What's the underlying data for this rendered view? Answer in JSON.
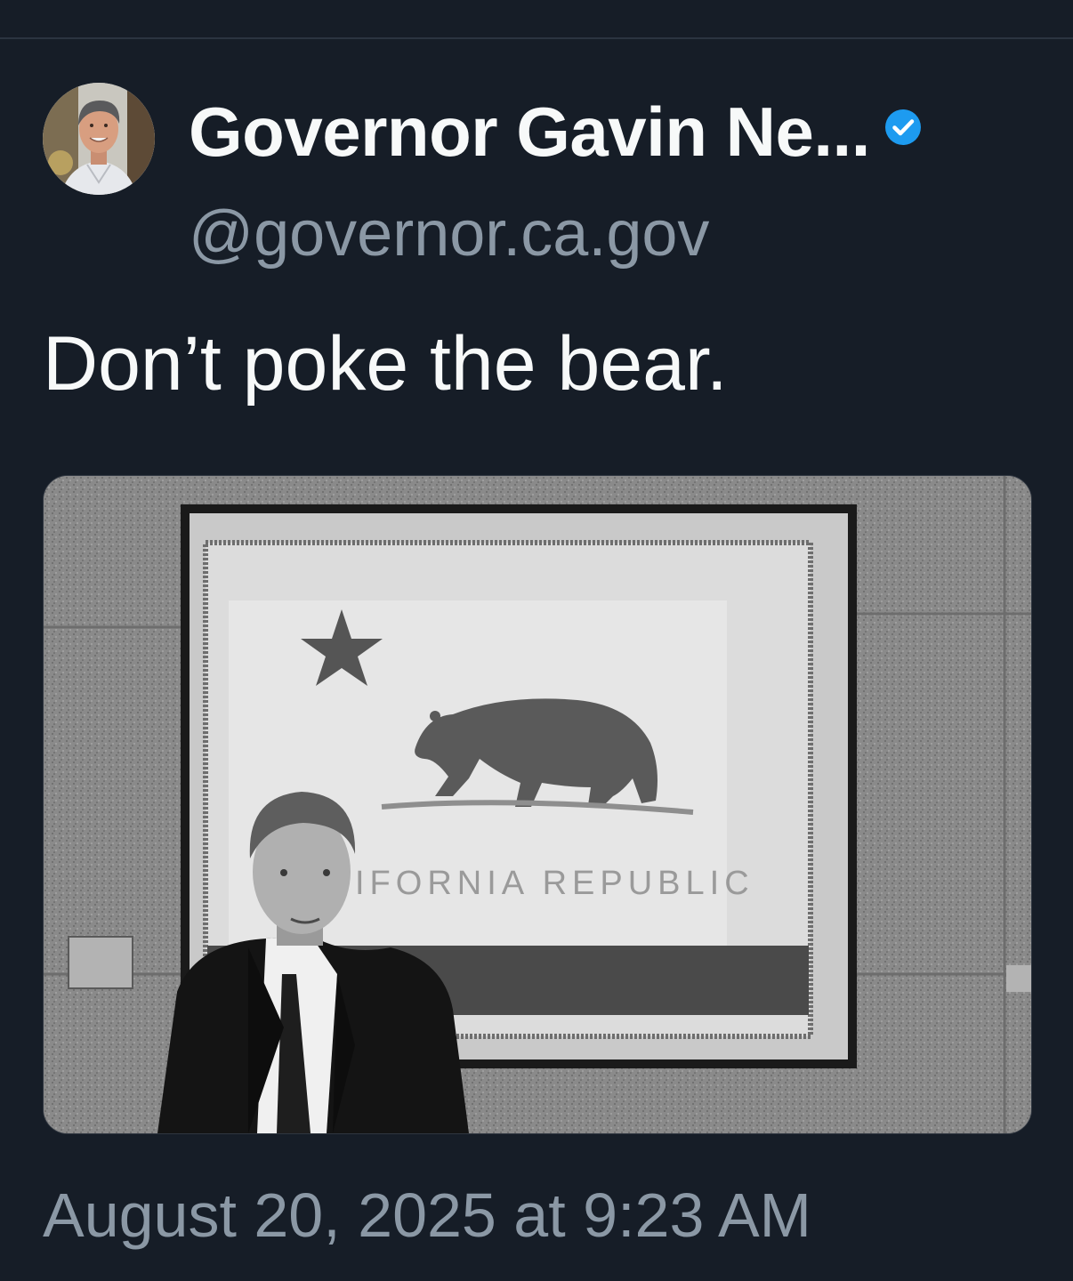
{
  "post": {
    "author": {
      "display_name": "Governor Gavin Ne...",
      "handle": "@governor.ca.gov",
      "verified": true,
      "avatar_icon": "profile-photo"
    },
    "text": "Don’t poke the bear.",
    "media": {
      "flag_text": "IFORNIA REPUBLIC"
    },
    "timestamp": "August 20, 2025 at 9:23 AM"
  },
  "colors": {
    "background": "#161d27",
    "primary_text": "#f7f9f9",
    "secondary_text": "#8b98a5",
    "verified_badge": "#1d9bf0"
  }
}
